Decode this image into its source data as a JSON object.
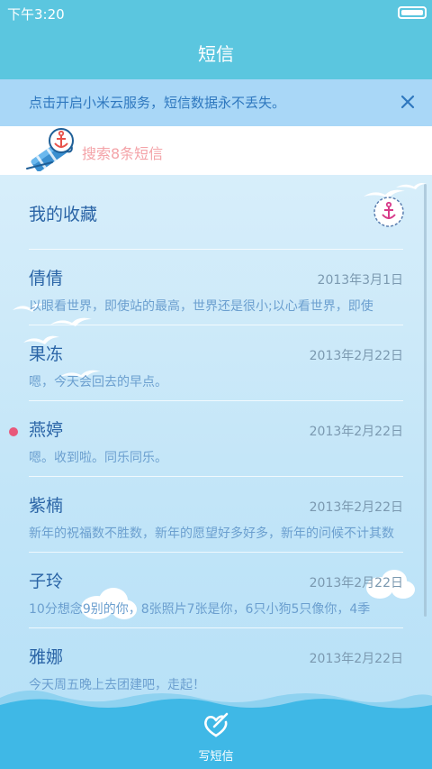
{
  "status_bar": {
    "time": "下午3:20"
  },
  "header": {
    "title": "短信"
  },
  "cloud_banner": {
    "text": "点击开启小米云服务，短信数据永不丢失。"
  },
  "search": {
    "placeholder": "搜索8条短信"
  },
  "favorites": {
    "label": "我的收藏"
  },
  "messages": [
    {
      "name": "倩倩",
      "date": "2013年3月1日",
      "preview": "以眼看世界，即使站的最高，世界还是很小;以心看世界，即使",
      "unread": false
    },
    {
      "name": "果冻",
      "date": "2013年2月22日",
      "preview": "嗯，今天会回去的早点。",
      "unread": false
    },
    {
      "name": "燕婷",
      "date": "2013年2月22日",
      "preview": "嗯。收到啦。同乐同乐。",
      "unread": true
    },
    {
      "name": "紫楠",
      "date": "2013年2月22日",
      "preview": "新年的祝福数不胜数，新年的愿望好多好多，新年的问候不计其数",
      "unread": false
    },
    {
      "name": "子玲",
      "date": "2013年2月22日",
      "preview": "10分想念9别的你，8张照片7张是你，6只小狗5只像你，4季",
      "unread": false
    },
    {
      "name": "雅娜",
      "date": "2013年2月22日",
      "preview": "今天周五晚上去团建吧，走起！",
      "unread": false
    }
  ],
  "bottom": {
    "compose_label": "写短信"
  },
  "colors": {
    "header": "#5bc6df",
    "banner": "#a9d7f7",
    "accent_text": "#2a64a6",
    "unread": "#e8587a",
    "search_text": "#f4a3a8"
  }
}
